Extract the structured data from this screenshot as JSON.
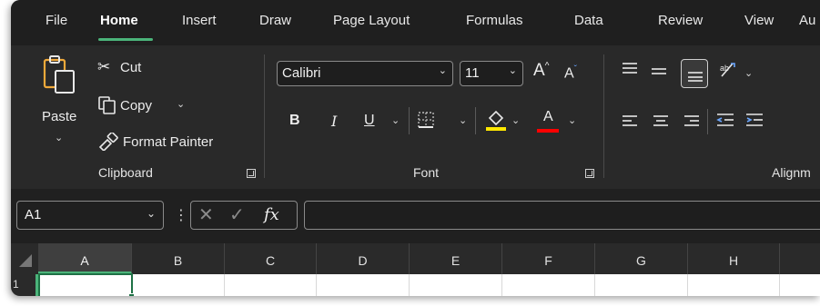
{
  "tabs": [
    "File",
    "Home",
    "Insert",
    "Draw",
    "Page Layout",
    "Formulas",
    "Data",
    "Review",
    "View",
    "Au"
  ],
  "active_tab": "Home",
  "clipboard": {
    "paste_label": "Paste",
    "cut_label": "Cut",
    "copy_label": "Copy",
    "format_painter_label": "Format Painter",
    "group_label": "Clipboard"
  },
  "font": {
    "font_name": "Calibri",
    "font_size": "11",
    "bold_label": "B",
    "italic_label": "I",
    "underline_label": "U",
    "font_color_label": "A",
    "grow_label": "A",
    "shrink_label": "A",
    "group_label": "Font",
    "highlight_color": "#ffe800",
    "font_color": "#ff0000"
  },
  "alignment": {
    "group_label": "Alignm"
  },
  "formula_bar": {
    "name_box_value": "A1",
    "fx_label": "fx",
    "formula_value": ""
  },
  "grid": {
    "columns": [
      "A",
      "B",
      "C",
      "D",
      "E",
      "F",
      "G",
      "H"
    ],
    "selected_column": "A",
    "rows": [
      "1"
    ]
  },
  "colors": {
    "accent": "#4bb47a",
    "cell_border": "#1e7145"
  }
}
